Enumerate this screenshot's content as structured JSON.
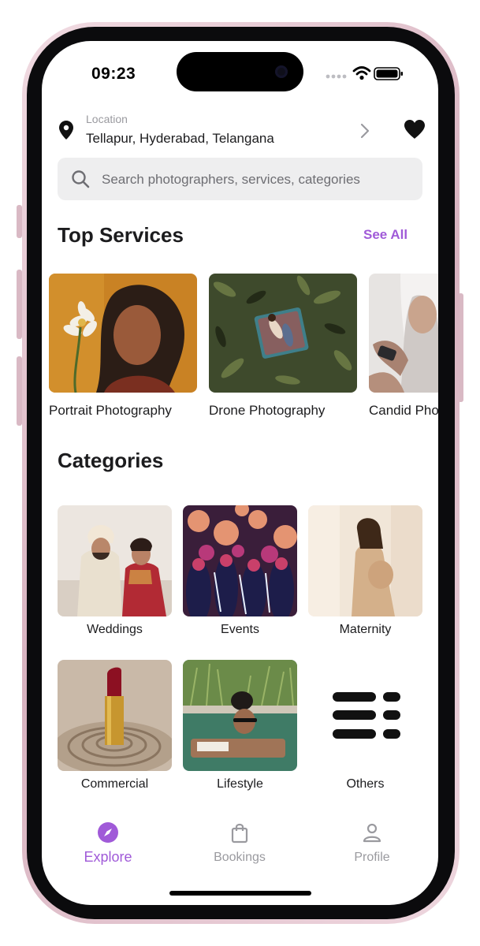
{
  "status": {
    "time": "09:23"
  },
  "location": {
    "caption": "Location",
    "address": "Tellapur, Hyderabad, Telangana"
  },
  "search": {
    "placeholder": "Search photographers, services, categories",
    "value": ""
  },
  "top_services": {
    "title": "Top Services",
    "see_all": "See All",
    "items": [
      {
        "label": "Portrait Photography"
      },
      {
        "label": "Drone Photography"
      },
      {
        "label": "Candid Photography"
      }
    ]
  },
  "categories": {
    "title": "Categories",
    "items": [
      {
        "label": "Weddings"
      },
      {
        "label": "Events"
      },
      {
        "label": "Maternity"
      },
      {
        "label": "Commercial"
      },
      {
        "label": "Lifestyle"
      },
      {
        "label": "Others"
      }
    ]
  },
  "tabbar": {
    "accent": "#a05ad8",
    "inactive": "#9a9a9f",
    "items": [
      {
        "label": "Explore",
        "icon": "compass-icon",
        "active": true
      },
      {
        "label": "Bookings",
        "icon": "shopping-bag-icon",
        "active": false
      },
      {
        "label": "Profile",
        "icon": "person-icon",
        "active": false
      }
    ]
  }
}
